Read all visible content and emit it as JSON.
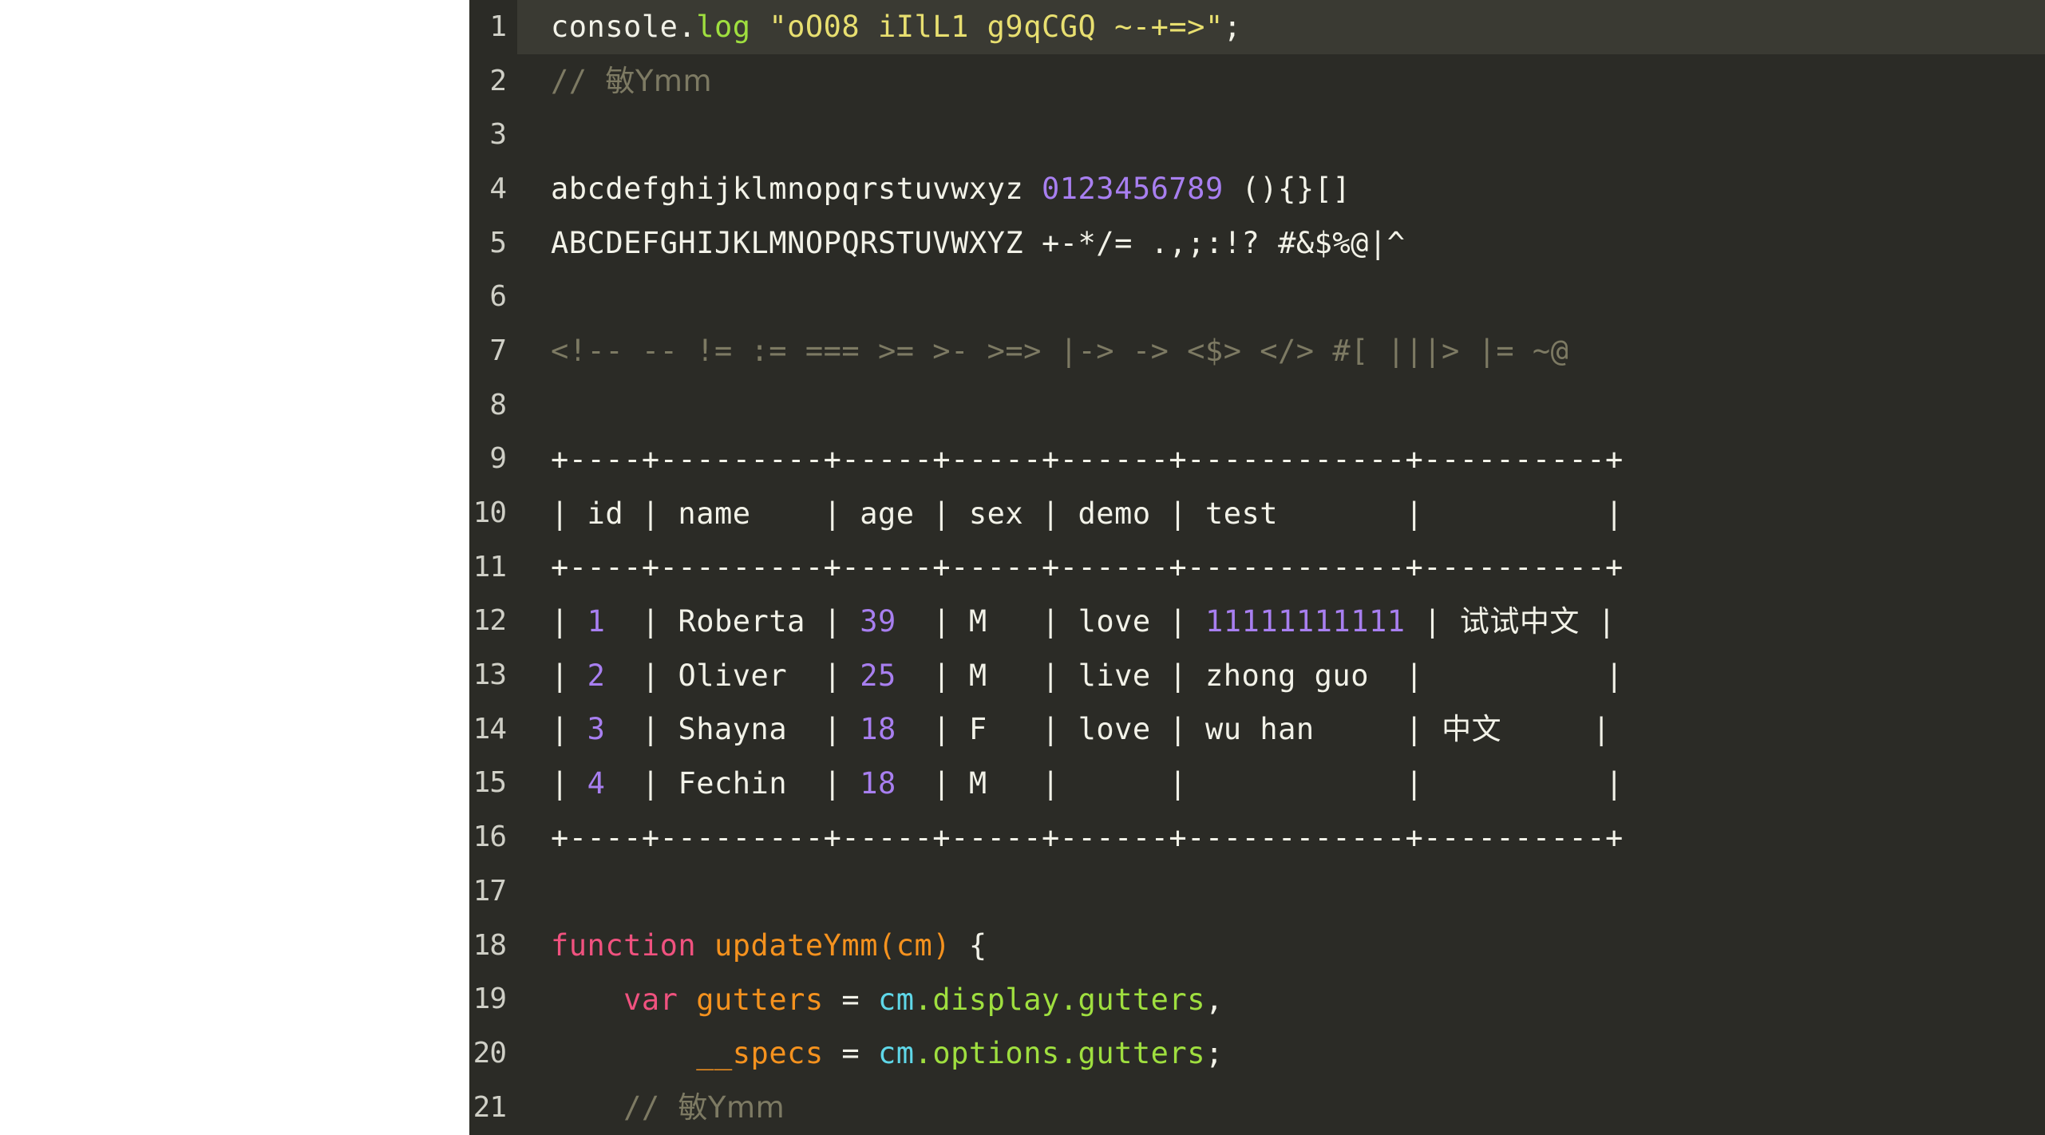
{
  "editor": {
    "theme_name": "dark-code-editor",
    "background": "#2b2b26",
    "active_line_background": "#3a3a33",
    "gutter_color": "#cfcfc6",
    "page_background": "#ffffff",
    "colors": {
      "text": "#f2f2e8",
      "method": "#9fdf3f",
      "string": "#e8df70",
      "number": "#a87ff0",
      "comment": "#7d7a63",
      "ligature": "#7d7a63",
      "keyword": "#f0527f",
      "variable": "#f5921e",
      "object": "#5fd7e8",
      "property": "#9fdf3f"
    },
    "active_line_number": 1,
    "lines": [
      {
        "n": "1",
        "text": "console.log \"oO08 iIlL1 g9qCGQ ~-+=>\";"
      },
      {
        "n": "2",
        "text": "// 敏Ymm"
      },
      {
        "n": "3",
        "text": ""
      },
      {
        "n": "4",
        "text": "abcdefghijklmnopqrstuvwxyz 0123456789 (){}[]"
      },
      {
        "n": "5",
        "text": "ABCDEFGHIJKLMNOPQRSTUVWXYZ +-*/= .,;:!? #&$%@|^"
      },
      {
        "n": "6",
        "text": ""
      },
      {
        "n": "7",
        "text": "<!-- -- != := === >= >- >=> |-> -> <$> </> #[ |||> |= ~@"
      },
      {
        "n": "8",
        "text": ""
      },
      {
        "n": "9",
        "text": "+----+---------+-----+-----+------+------------+----------+"
      },
      {
        "n": "10",
        "text": "| id | name    | age | sex | demo | test       |          |"
      },
      {
        "n": "11",
        "text": "+----+---------+-----+-----+------+------------+----------+"
      },
      {
        "n": "12",
        "text": "| 1  | Roberta | 39  | M   | love | 11111111111 | 试试中文 |"
      },
      {
        "n": "13",
        "text": "| 2  | Oliver  | 25  | M   | live | zhong guo  |          |"
      },
      {
        "n": "14",
        "text": "| 3  | Shayna  | 18  | F   | love | wu han     | 中文     |"
      },
      {
        "n": "15",
        "text": "| 4  | Fechin  | 18  | M   |      |            |          |"
      },
      {
        "n": "16",
        "text": "+----+---------+-----+-----+------+------------+----------+"
      },
      {
        "n": "17",
        "text": ""
      },
      {
        "n": "18",
        "text": "function updateYmm(cm) {"
      },
      {
        "n": "19",
        "text": "    var gutters = cm.display.gutters,"
      },
      {
        "n": "20",
        "text": "        __specs = cm.options.gutters;"
      },
      {
        "n": "21",
        "text": "    // 敏Ymm"
      }
    ],
    "tokens": {
      "line1": {
        "object": "console",
        "dot": ".",
        "method": "log",
        "space": " ",
        "string": "\"oO08 iIlL1 g9qCGQ ~-+=>\"",
        "semicolon": ";"
      },
      "line2": {
        "comment_slashes": "// ",
        "comment_text": "敏Ymm"
      },
      "line4": {
        "lower": "abcdefghijklmnopqrstuvwxyz",
        "digits": "0123456789",
        "brackets": "(){}[]"
      },
      "line5": {
        "upper": "ABCDEFGHIJKLMNOPQRSTUVWXYZ",
        "math": "+-*/=",
        "punct": ".,;:!?",
        "symbols": "#&$%@|^"
      },
      "line7": {
        "ligatures": "<!-- -- != := === >= >- >=> |-> -> <$> </> #[ |||> |= ~@"
      },
      "line18": {
        "keyword": "function",
        "name": "updateYmm",
        "open_paren": "(",
        "param": "cm",
        "close_paren": ")",
        "brace": " {"
      },
      "line19": {
        "keyword": "var",
        "name": "gutters",
        "equals": " = ",
        "object": "cm",
        "prop1": ".display",
        "prop2": ".gutters",
        "comma": ","
      },
      "line20": {
        "name": "__specs",
        "equals": " = ",
        "object": "cm",
        "prop1": ".options",
        "prop2": ".gutters",
        "semicolon": ";"
      },
      "line21": {
        "comment_slashes": "// ",
        "comment_text": "敏Ymm"
      }
    },
    "table": {
      "headers": [
        "id",
        "name",
        "age",
        "sex",
        "demo",
        "test",
        ""
      ],
      "rows": [
        {
          "id": "1",
          "name": "Roberta",
          "age": "39",
          "sex": "M",
          "demo": "love",
          "test": "11111111111",
          "extra": "试试中文"
        },
        {
          "id": "2",
          "name": "Oliver",
          "age": "25",
          "sex": "M",
          "demo": "live",
          "test": "zhong guo",
          "extra": ""
        },
        {
          "id": "3",
          "name": "Shayna",
          "age": "18",
          "sex": "F",
          "demo": "love",
          "test": "wu han",
          "extra": "中文"
        },
        {
          "id": "4",
          "name": "Fechin",
          "age": "18",
          "sex": "M",
          "demo": "",
          "test": "",
          "extra": ""
        }
      ]
    }
  }
}
